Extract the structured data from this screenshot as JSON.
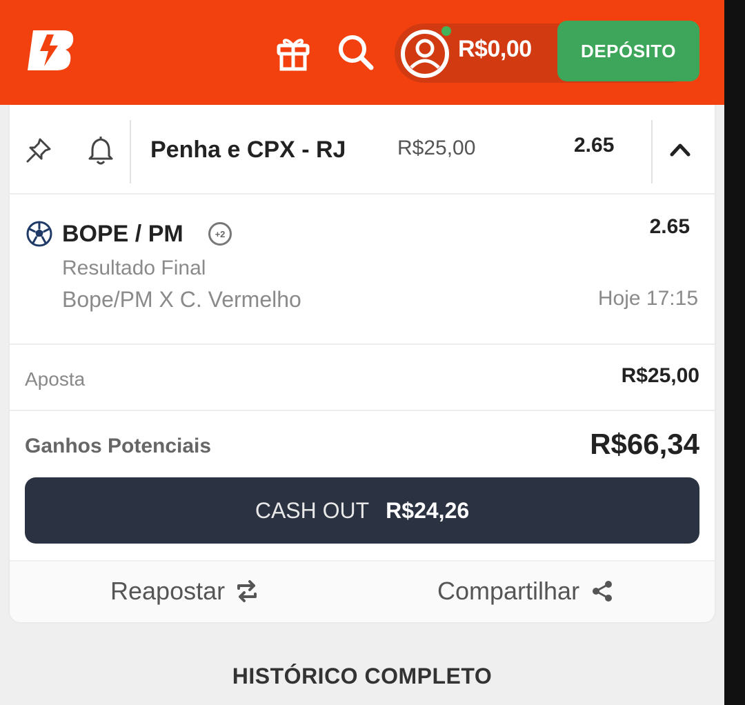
{
  "header": {
    "logo_text": "B",
    "balance": "R$0,00",
    "deposit_label": "DEPÓSITO"
  },
  "bet": {
    "title": "Penha e CPX - RJ",
    "stake": "R$25,00",
    "odds": "2.65"
  },
  "selection": {
    "name": "BOPE / PM",
    "extra_badge": "+2",
    "odds": "2.65",
    "market": "Resultado Final",
    "match": "Bope/PM X C. Vermelho",
    "time": "Hoje 17:15"
  },
  "summary": {
    "stake_label": "Aposta",
    "stake_value": "R$25,00",
    "potential_label": "Ganhos Potenciais",
    "potential_value": "R$66,34"
  },
  "cashout": {
    "label": "CASH OUT",
    "value": "R$24,26"
  },
  "footer": {
    "rebet_label": "Reapostar",
    "share_label": "Compartilhar",
    "history_label": "HISTÓRICO COMPLETO"
  },
  "colors": {
    "header_bg": "#f2410f",
    "deposit_bg": "#3ea65a",
    "cashout_bg": "#2b3242"
  },
  "icons": [
    "gift-icon",
    "search-icon",
    "user-icon",
    "pin-icon",
    "bell-icon",
    "chevron-up-icon",
    "soccer-ball-icon",
    "repeat-icon",
    "share-icon"
  ]
}
